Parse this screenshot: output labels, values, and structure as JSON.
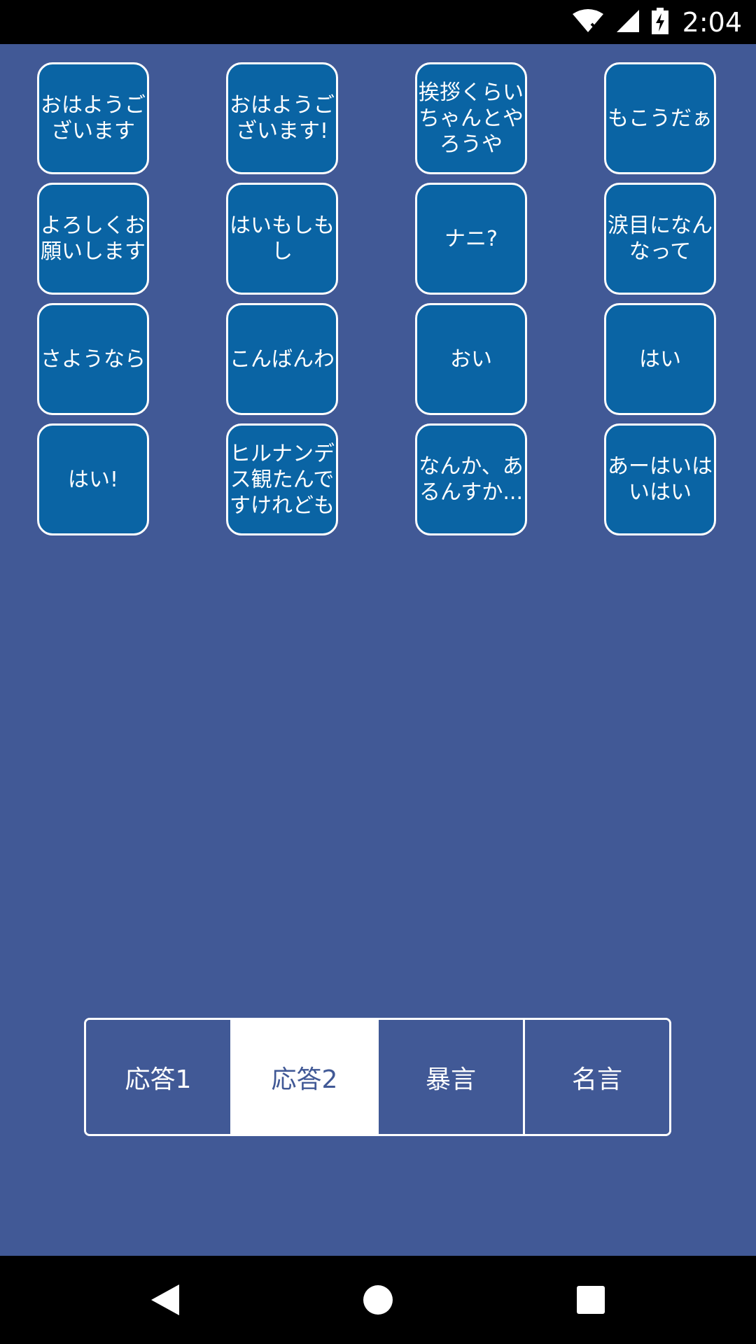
{
  "status_bar": {
    "time": "2:04",
    "icons": [
      "wifi-icon",
      "signal-icon",
      "battery-charging-icon"
    ]
  },
  "sound_buttons": [
    "おはようございます",
    "おはようございます!",
    "挨拶くらいちゃんとやろうや",
    "もこうだぁ",
    "よろしくお願いします",
    "はいもしもし",
    "ナニ?",
    "涙目になんなって",
    "さようなら",
    "こんばんわ",
    "おい",
    "はい",
    "はい!",
    "ヒルナンデス観たんですけれども",
    "なんか、あるんすか...",
    "あーはいはいはい"
  ],
  "tabs": [
    {
      "label": "応答1",
      "active": false
    },
    {
      "label": "応答2",
      "active": true
    },
    {
      "label": "暴言",
      "active": false
    },
    {
      "label": "名言",
      "active": false
    }
  ],
  "nav_bar": {
    "icons": [
      "back-icon",
      "home-icon",
      "recents-icon"
    ]
  },
  "colors": {
    "background": "#415996",
    "button_fill": "#0a64a4",
    "button_border": "#ffffff",
    "active_tab_bg": "#ffffff"
  }
}
